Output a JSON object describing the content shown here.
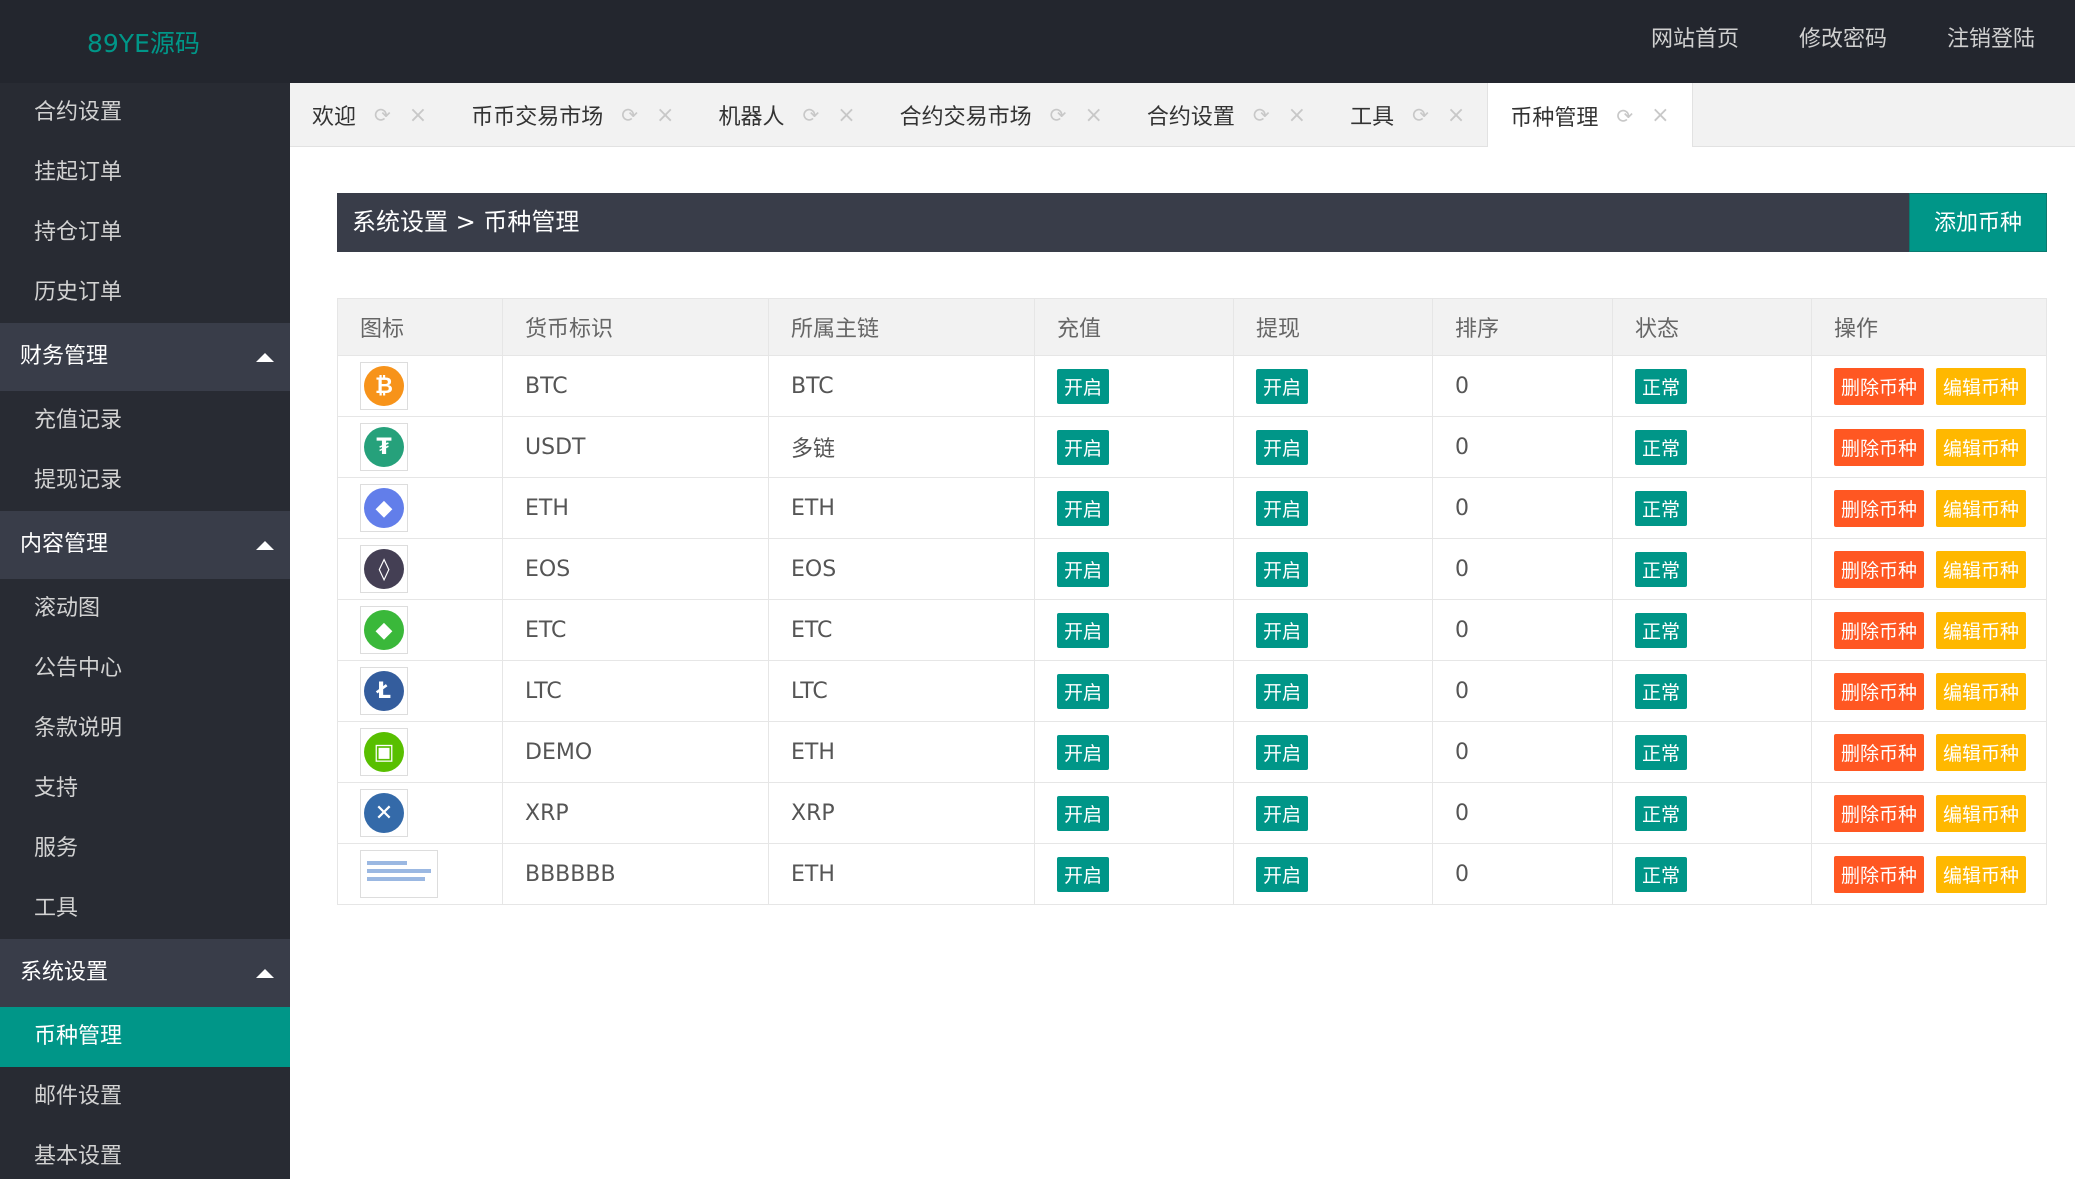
{
  "header": {
    "logo": "89YE源码",
    "nav": [
      "网站首页",
      "修改密码",
      "注销登陆"
    ]
  },
  "sidebar": {
    "top_items": [
      "合约设置",
      "挂起订单",
      "持仓订单",
      "历史订单"
    ],
    "groups": [
      {
        "label": "财务管理",
        "items": [
          "充值记录",
          "提现记录"
        ]
      },
      {
        "label": "内容管理",
        "items": [
          "滚动图",
          "公告中心",
          "条款说明",
          "支持",
          "服务",
          "工具"
        ]
      },
      {
        "label": "系统设置",
        "items": [
          "币种管理",
          "邮件设置",
          "基本设置"
        ]
      }
    ],
    "active": "币种管理"
  },
  "tabs": [
    "欢迎",
    "币币交易市场",
    "机器人",
    "合约交易市场",
    "合约设置",
    "工具",
    "币种管理"
  ],
  "active_tab": "币种管理",
  "page": {
    "breadcrumb": "系统设置 > 币种管理",
    "add_button": "添加币种"
  },
  "table": {
    "columns": [
      "图标",
      "货币标识",
      "所属主链",
      "充值",
      "提现",
      "排序",
      "状态",
      "操作"
    ],
    "rows": [
      {
        "icon": "btc-icon",
        "color": "#f7931a",
        "glyph": "₿",
        "symbol": "BTC",
        "chain": "BTC",
        "recharge": "开启",
        "withdraw": "开启",
        "sort": "0",
        "status": "正常"
      },
      {
        "icon": "usdt-icon",
        "color": "#26a17b",
        "glyph": "₮",
        "symbol": "USDT",
        "chain": "多链",
        "recharge": "开启",
        "withdraw": "开启",
        "sort": "0",
        "status": "正常"
      },
      {
        "icon": "eth-icon",
        "color": "#627eea",
        "glyph": "◆",
        "symbol": "ETH",
        "chain": "ETH",
        "recharge": "开启",
        "withdraw": "开启",
        "sort": "0",
        "status": "正常"
      },
      {
        "icon": "eos-icon",
        "color": "#443f54",
        "glyph": "◊",
        "symbol": "EOS",
        "chain": "EOS",
        "recharge": "开启",
        "withdraw": "开启",
        "sort": "0",
        "status": "正常"
      },
      {
        "icon": "etc-icon",
        "color": "#3ab83a",
        "glyph": "◆",
        "symbol": "ETC",
        "chain": "ETC",
        "recharge": "开启",
        "withdraw": "开启",
        "sort": "0",
        "status": "正常"
      },
      {
        "icon": "ltc-icon",
        "color": "#345d9d",
        "glyph": "Ł",
        "symbol": "LTC",
        "chain": "LTC",
        "recharge": "开启",
        "withdraw": "开启",
        "sort": "0",
        "status": "正常"
      },
      {
        "icon": "demo-icon",
        "color": "#58bf00",
        "glyph": "▣",
        "symbol": "DEMO",
        "chain": "ETH",
        "recharge": "开启",
        "withdraw": "开启",
        "sort": "0",
        "status": "正常"
      },
      {
        "icon": "xrp-icon",
        "color": "#346aa9",
        "glyph": "✕",
        "symbol": "XRP",
        "chain": "XRP",
        "recharge": "开启",
        "withdraw": "开启",
        "sort": "0",
        "status": "正常"
      },
      {
        "icon": "image-thumbnail",
        "color": "",
        "glyph": "",
        "symbol": "BBBBBB",
        "chain": "ETH",
        "recharge": "开启",
        "withdraw": "开启",
        "sort": "0",
        "status": "正常"
      }
    ],
    "delete_label": "删除币种",
    "edit_label": "编辑币种"
  },
  "colors": {
    "accent": "#009688",
    "danger": "#ff5722",
    "warn": "#ffb800",
    "dark": "#393d49"
  }
}
